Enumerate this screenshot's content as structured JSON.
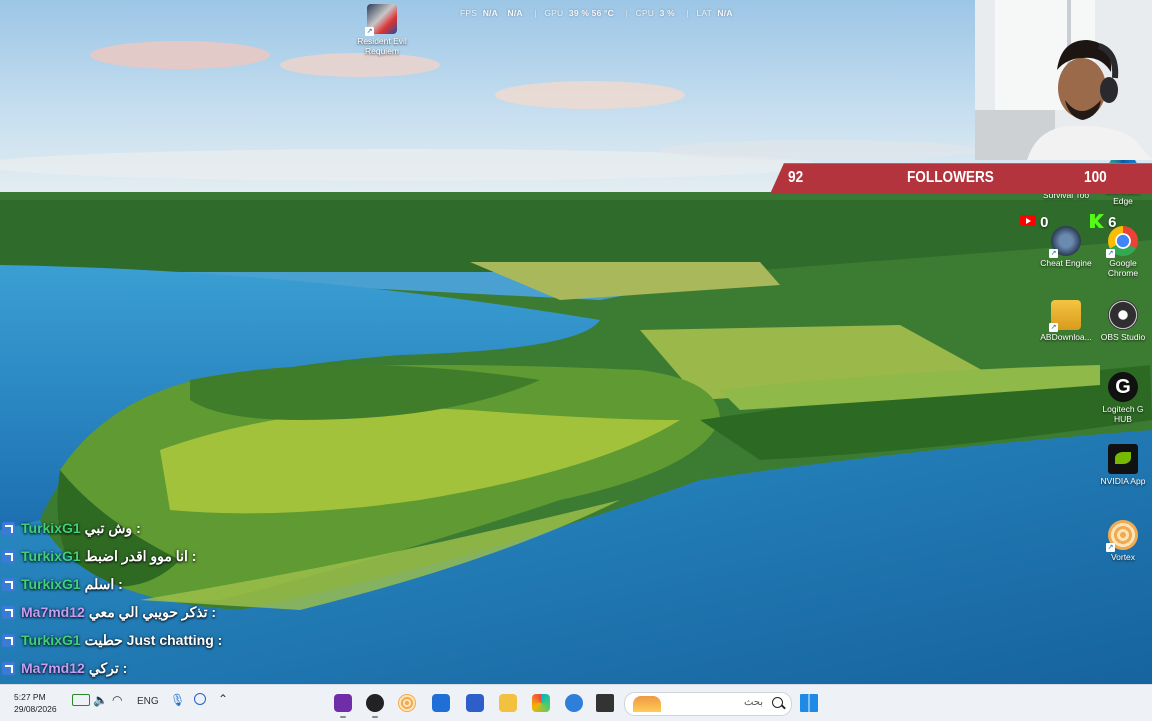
{
  "overlay_stats": {
    "fps_label": "FPS",
    "fps_value": "N/A",
    "fps_value2": "N/A",
    "gpu_label": "GPU",
    "gpu_value": "39 % 56 °C",
    "cpu_label": "CPU",
    "cpu_value": "3 %",
    "lat_label": "LAT",
    "lat_value": "N/A"
  },
  "desktop_icons": [
    {
      "name": "Resident Evil Requiem",
      "line1": "Resident Evil",
      "line2": "Requiem"
    },
    {
      "name": "Survival Tool",
      "line1": "Survival Too",
      "line2": ""
    },
    {
      "name": "Microsoft Edge",
      "line1": "Microsoft",
      "line2": "Edge"
    },
    {
      "name": "Cheat Engine",
      "line1": "Cheat Engine",
      "line2": ""
    },
    {
      "name": "Google Chrome",
      "line1": "Google",
      "line2": "Chrome"
    },
    {
      "name": "ABDownloader",
      "line1": "ABDownloa...",
      "line2": ""
    },
    {
      "name": "OBS Studio",
      "line1": "OBS Studio",
      "line2": ""
    },
    {
      "name": "Logitech G HUB",
      "line1": "Logitech G",
      "line2": "HUB"
    },
    {
      "name": "NVIDIA App",
      "line1": "NVIDIA App",
      "line2": ""
    },
    {
      "name": "Vortex",
      "line1": "Vortex",
      "line2": ""
    }
  ],
  "followers_goal": {
    "current": "92",
    "label": "FOLLOWERS",
    "goal": "100",
    "color": "#b3343d"
  },
  "social_counters": {
    "youtube": "0",
    "kick": "6"
  },
  "chat": [
    {
      "user": "TurkixG1",
      "message": "وش تبي :",
      "color": "#3fd17a"
    },
    {
      "user": "TurkixG1",
      "message": "انا موو اقدر اضبط :",
      "color": "#3fd17a"
    },
    {
      "user": "TurkixG1",
      "message": "اسلم :",
      "color": "#3fd17a"
    },
    {
      "user": "Ma7md12",
      "message": "تذكر حويبي الي معي :",
      "color": "#c79cf5"
    },
    {
      "user": "TurkixG1",
      "message": "حطيت Just chatting :",
      "color": "#3fd17a"
    },
    {
      "user": "Ma7md12",
      "message": "تركي :",
      "color": "#c79cf5"
    }
  ],
  "taskbar": {
    "time": "5:27 PM",
    "date": "29/08/2026",
    "language": "ENG",
    "search_placeholder": "بحث"
  }
}
